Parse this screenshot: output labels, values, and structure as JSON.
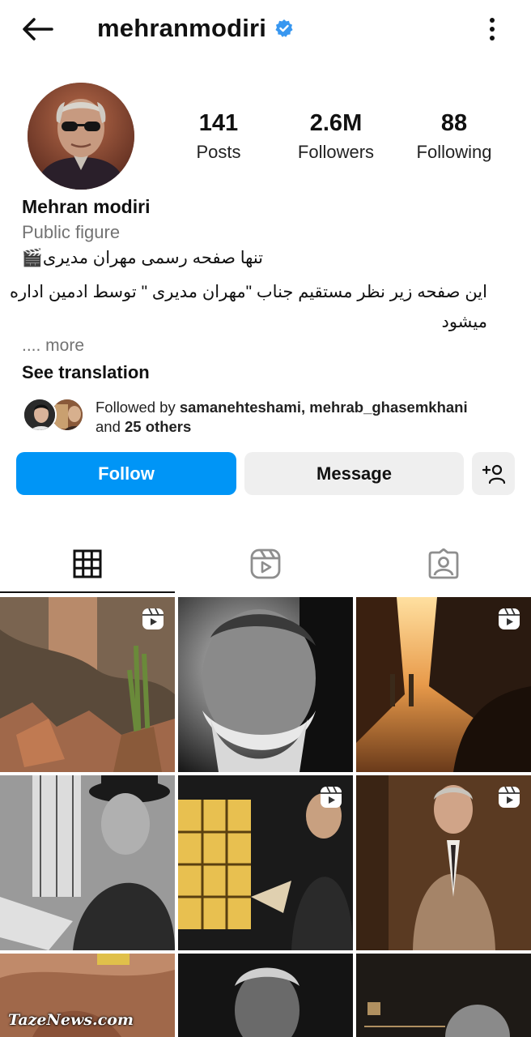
{
  "header": {
    "username": "mehranmodiri",
    "back_icon": "arrow-left-icon",
    "verified_icon": "verified-badge-icon",
    "more_icon": "more-vertical-icon"
  },
  "profile": {
    "stats": {
      "posts_count": "141",
      "posts_label": "Posts",
      "followers_count": "2.6M",
      "followers_label": "Followers",
      "following_count": "88",
      "following_label": "Following"
    },
    "name": "Mehran modiri",
    "category": "Public figure",
    "bio_line1": "تنها صفحه رسمی  مهران مدیری🎬",
    "bio_line2": "این صفحه زیر نظر مستقیم جناب \"مهران مدیری \" توسط ادمین اداره میشود",
    "more_text": ".... more",
    "see_translation": "See translation",
    "followed_by_prefix": "Followed by ",
    "followed_by_users": "samanehteshami, mehrab_ghasemkhani",
    "followed_by_and": "and ",
    "followed_by_others": "25 others"
  },
  "actions": {
    "follow_label": "Follow",
    "message_label": "Message",
    "add_user_icon": "add-user-icon"
  },
  "tabs": [
    {
      "name": "posts-grid",
      "icon": "grid-icon",
      "active": true
    },
    {
      "name": "reels",
      "icon": "reels-icon",
      "active": false
    },
    {
      "name": "tagged",
      "icon": "tagged-user-icon",
      "active": false
    }
  ],
  "colors": {
    "primary_blue": "#0095f6",
    "secondary_gray": "#efefef",
    "muted_text": "#737373"
  },
  "watermark": "TazeNews.com"
}
